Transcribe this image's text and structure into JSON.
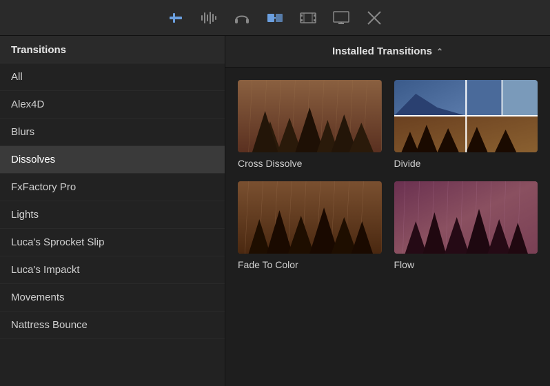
{
  "toolbar": {
    "icons": [
      {
        "name": "trim-icon",
        "symbol": "trim",
        "active": false
      },
      {
        "name": "audio-icon",
        "symbol": "audio",
        "active": false
      },
      {
        "name": "headphones-icon",
        "symbol": "headphones",
        "active": false
      },
      {
        "name": "transitions-icon",
        "symbol": "transitions",
        "active": true
      },
      {
        "name": "film-icon",
        "symbol": "film",
        "active": false
      },
      {
        "name": "monitor-icon",
        "symbol": "monitor",
        "active": false
      },
      {
        "name": "crosshair-icon",
        "symbol": "crosshair",
        "active": false
      }
    ]
  },
  "sidebar": {
    "title": "Transitions",
    "items": [
      {
        "label": "All",
        "selected": false
      },
      {
        "label": "Alex4D",
        "selected": false
      },
      {
        "label": "Blurs",
        "selected": false
      },
      {
        "label": "Dissolves",
        "selected": true
      },
      {
        "label": "FxFactory Pro",
        "selected": false
      },
      {
        "label": "Lights",
        "selected": false
      },
      {
        "label": "Luca's Sprocket Slip",
        "selected": false
      },
      {
        "label": "Luca's Impackt",
        "selected": false
      },
      {
        "label": "Movements",
        "selected": false
      },
      {
        "label": "Nattress Bounce",
        "selected": false
      }
    ]
  },
  "content": {
    "header": "Installed Transitions",
    "sort_icon": "⌃",
    "items": [
      {
        "label": "Cross Dissolve",
        "thumb_type": "cross-dissolve"
      },
      {
        "label": "Divide",
        "thumb_type": "divide"
      },
      {
        "label": "Fade To Color",
        "thumb_type": "fade-to-color"
      },
      {
        "label": "Flow",
        "thumb_type": "flow"
      }
    ]
  }
}
